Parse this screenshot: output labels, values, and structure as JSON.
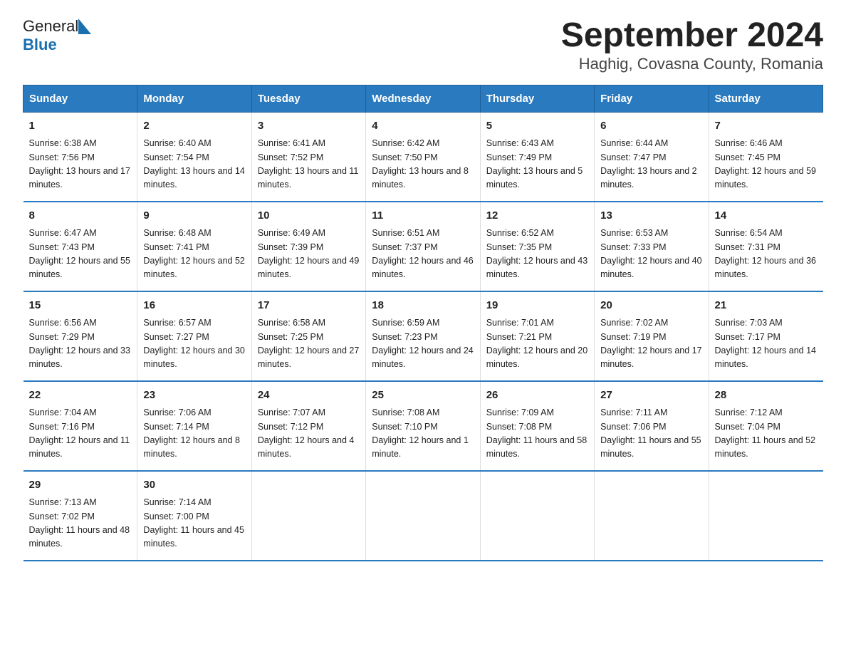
{
  "header": {
    "logo_general": "General",
    "logo_blue": "Blue",
    "title": "September 2024",
    "subtitle": "Haghig, Covasna County, Romania"
  },
  "days_of_week": [
    "Sunday",
    "Monday",
    "Tuesday",
    "Wednesday",
    "Thursday",
    "Friday",
    "Saturday"
  ],
  "weeks": [
    [
      {
        "date": "1",
        "sunrise": "6:38 AM",
        "sunset": "7:56 PM",
        "daylight": "13 hours and 17 minutes."
      },
      {
        "date": "2",
        "sunrise": "6:40 AM",
        "sunset": "7:54 PM",
        "daylight": "13 hours and 14 minutes."
      },
      {
        "date": "3",
        "sunrise": "6:41 AM",
        "sunset": "7:52 PM",
        "daylight": "13 hours and 11 minutes."
      },
      {
        "date": "4",
        "sunrise": "6:42 AM",
        "sunset": "7:50 PM",
        "daylight": "13 hours and 8 minutes."
      },
      {
        "date": "5",
        "sunrise": "6:43 AM",
        "sunset": "7:49 PM",
        "daylight": "13 hours and 5 minutes."
      },
      {
        "date": "6",
        "sunrise": "6:44 AM",
        "sunset": "7:47 PM",
        "daylight": "13 hours and 2 minutes."
      },
      {
        "date": "7",
        "sunrise": "6:46 AM",
        "sunset": "7:45 PM",
        "daylight": "12 hours and 59 minutes."
      }
    ],
    [
      {
        "date": "8",
        "sunrise": "6:47 AM",
        "sunset": "7:43 PM",
        "daylight": "12 hours and 55 minutes."
      },
      {
        "date": "9",
        "sunrise": "6:48 AM",
        "sunset": "7:41 PM",
        "daylight": "12 hours and 52 minutes."
      },
      {
        "date": "10",
        "sunrise": "6:49 AM",
        "sunset": "7:39 PM",
        "daylight": "12 hours and 49 minutes."
      },
      {
        "date": "11",
        "sunrise": "6:51 AM",
        "sunset": "7:37 PM",
        "daylight": "12 hours and 46 minutes."
      },
      {
        "date": "12",
        "sunrise": "6:52 AM",
        "sunset": "7:35 PM",
        "daylight": "12 hours and 43 minutes."
      },
      {
        "date": "13",
        "sunrise": "6:53 AM",
        "sunset": "7:33 PM",
        "daylight": "12 hours and 40 minutes."
      },
      {
        "date": "14",
        "sunrise": "6:54 AM",
        "sunset": "7:31 PM",
        "daylight": "12 hours and 36 minutes."
      }
    ],
    [
      {
        "date": "15",
        "sunrise": "6:56 AM",
        "sunset": "7:29 PM",
        "daylight": "12 hours and 33 minutes."
      },
      {
        "date": "16",
        "sunrise": "6:57 AM",
        "sunset": "7:27 PM",
        "daylight": "12 hours and 30 minutes."
      },
      {
        "date": "17",
        "sunrise": "6:58 AM",
        "sunset": "7:25 PM",
        "daylight": "12 hours and 27 minutes."
      },
      {
        "date": "18",
        "sunrise": "6:59 AM",
        "sunset": "7:23 PM",
        "daylight": "12 hours and 24 minutes."
      },
      {
        "date": "19",
        "sunrise": "7:01 AM",
        "sunset": "7:21 PM",
        "daylight": "12 hours and 20 minutes."
      },
      {
        "date": "20",
        "sunrise": "7:02 AM",
        "sunset": "7:19 PM",
        "daylight": "12 hours and 17 minutes."
      },
      {
        "date": "21",
        "sunrise": "7:03 AM",
        "sunset": "7:17 PM",
        "daylight": "12 hours and 14 minutes."
      }
    ],
    [
      {
        "date": "22",
        "sunrise": "7:04 AM",
        "sunset": "7:16 PM",
        "daylight": "12 hours and 11 minutes."
      },
      {
        "date": "23",
        "sunrise": "7:06 AM",
        "sunset": "7:14 PM",
        "daylight": "12 hours and 8 minutes."
      },
      {
        "date": "24",
        "sunrise": "7:07 AM",
        "sunset": "7:12 PM",
        "daylight": "12 hours and 4 minutes."
      },
      {
        "date": "25",
        "sunrise": "7:08 AM",
        "sunset": "7:10 PM",
        "daylight": "12 hours and 1 minute."
      },
      {
        "date": "26",
        "sunrise": "7:09 AM",
        "sunset": "7:08 PM",
        "daylight": "11 hours and 58 minutes."
      },
      {
        "date": "27",
        "sunrise": "7:11 AM",
        "sunset": "7:06 PM",
        "daylight": "11 hours and 55 minutes."
      },
      {
        "date": "28",
        "sunrise": "7:12 AM",
        "sunset": "7:04 PM",
        "daylight": "11 hours and 52 minutes."
      }
    ],
    [
      {
        "date": "29",
        "sunrise": "7:13 AM",
        "sunset": "7:02 PM",
        "daylight": "11 hours and 48 minutes."
      },
      {
        "date": "30",
        "sunrise": "7:14 AM",
        "sunset": "7:00 PM",
        "daylight": "11 hours and 45 minutes."
      },
      {
        "date": "",
        "sunrise": "",
        "sunset": "",
        "daylight": ""
      },
      {
        "date": "",
        "sunrise": "",
        "sunset": "",
        "daylight": ""
      },
      {
        "date": "",
        "sunrise": "",
        "sunset": "",
        "daylight": ""
      },
      {
        "date": "",
        "sunrise": "",
        "sunset": "",
        "daylight": ""
      },
      {
        "date": "",
        "sunrise": "",
        "sunset": "",
        "daylight": ""
      }
    ]
  ]
}
